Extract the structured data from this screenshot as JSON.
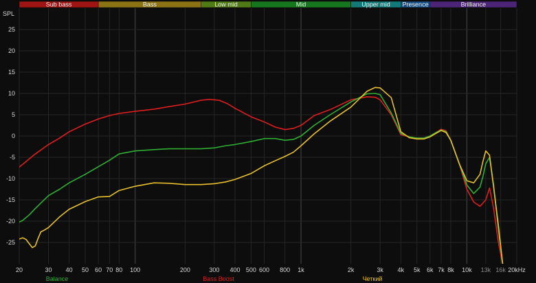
{
  "chart_data": {
    "type": "line",
    "title": "",
    "xlabel": "",
    "ylabel": "SPL",
    "x_scale": "log",
    "xlim": [
      20,
      20000
    ],
    "ylim": [
      -30,
      30
    ],
    "grid": true,
    "background": "#0d0d0d",
    "grid_color": "#2e2e2e",
    "bands": [
      {
        "label": "Sub bass",
        "from": 20,
        "to": 60,
        "color": "#a01414"
      },
      {
        "label": "Bass",
        "from": 60,
        "to": 250,
        "color": "#8c7414"
      },
      {
        "label": "Low mid",
        "from": 250,
        "to": 500,
        "color": "#4f7a14"
      },
      {
        "label": "Mid",
        "from": 500,
        "to": 2000,
        "color": "#16781e"
      },
      {
        "label": "Upper mid",
        "from": 2000,
        "to": 4000,
        "color": "#127a78"
      },
      {
        "label": "Presence",
        "from": 4000,
        "to": 6000,
        "color": "#154e86"
      },
      {
        "label": "Brilliance",
        "from": 6000,
        "to": 20000,
        "color": "#4c2578"
      }
    ],
    "x_ticks": [
      {
        "value": 20,
        "label": "20",
        "dim": false
      },
      {
        "value": 30,
        "label": "30",
        "dim": false
      },
      {
        "value": 40,
        "label": "40",
        "dim": false
      },
      {
        "value": 50,
        "label": "50",
        "dim": false
      },
      {
        "value": 60,
        "label": "60",
        "dim": false
      },
      {
        "value": 70,
        "label": "70",
        "dim": false
      },
      {
        "value": 80,
        "label": "80",
        "dim": false
      },
      {
        "value": 100,
        "label": "100",
        "dim": false
      },
      {
        "value": 200,
        "label": "200",
        "dim": false
      },
      {
        "value": 300,
        "label": "300",
        "dim": false
      },
      {
        "value": 400,
        "label": "400",
        "dim": false
      },
      {
        "value": 500,
        "label": "500",
        "dim": false
      },
      {
        "value": 600,
        "label": "600",
        "dim": false
      },
      {
        "value": 800,
        "label": "800",
        "dim": false
      },
      {
        "value": 1000,
        "label": "1k",
        "dim": false
      },
      {
        "value": 2000,
        "label": "2k",
        "dim": false
      },
      {
        "value": 3000,
        "label": "3k",
        "dim": false
      },
      {
        "value": 4000,
        "label": "4k",
        "dim": false
      },
      {
        "value": 5000,
        "label": "5k",
        "dim": false
      },
      {
        "value": 6000,
        "label": "6k",
        "dim": false
      },
      {
        "value": 7000,
        "label": "7k",
        "dim": false
      },
      {
        "value": 8000,
        "label": "8k",
        "dim": false
      },
      {
        "value": 10000,
        "label": "10k",
        "dim": false
      },
      {
        "value": 13000,
        "label": "13k",
        "dim": true
      },
      {
        "value": 16000,
        "label": "16k",
        "dim": true
      },
      {
        "value": 20000,
        "label": "20kHz",
        "dim": false
      }
    ],
    "y_ticks": [
      25,
      20,
      15,
      10,
      5,
      0,
      -5,
      -10,
      -15,
      -20,
      -25
    ],
    "major_x_gridlines": [
      100,
      1000,
      10000
    ],
    "series": [
      {
        "name": "Bass Boost",
        "color": "#e01e1e",
        "x": [
          20,
          25,
          30,
          35,
          40,
          50,
          60,
          70,
          80,
          100,
          130,
          160,
          200,
          250,
          280,
          320,
          360,
          400,
          500,
          600,
          700,
          800,
          900,
          1000,
          1200,
          1500,
          2000,
          2500,
          2800,
          3000,
          3500,
          4000,
          4500,
          5000,
          5500,
          6000,
          6500,
          7000,
          7500,
          8000,
          9000,
          10000,
          11000,
          12000,
          13000,
          13700,
          14500,
          15500,
          16500
        ],
        "y": [
          -7.3,
          -4.2,
          -2,
          -0.5,
          1,
          2.8,
          4,
          4.8,
          5.3,
          5.8,
          6.3,
          6.9,
          7.5,
          8.4,
          8.6,
          8.4,
          7.6,
          6.5,
          4.5,
          3.3,
          2.1,
          1.5,
          1.8,
          2.5,
          4.8,
          6.2,
          8.5,
          9.2,
          9.1,
          8.5,
          5,
          0.3,
          -0.2,
          -0.5,
          -0.5,
          0,
          0.8,
          1.6,
          1.2,
          -1,
          -6.5,
          -12.5,
          -15.5,
          -16.5,
          -15,
          -12.2,
          -17,
          -25,
          -30.5
        ]
      },
      {
        "name": "Balance",
        "color": "#2fb032",
        "x": [
          20,
          21,
          23,
          25,
          30,
          35,
          40,
          50,
          60,
          70,
          80,
          100,
          130,
          160,
          200,
          250,
          300,
          350,
          400,
          500,
          600,
          700,
          800,
          900,
          1000,
          1200,
          1500,
          2000,
          2500,
          2800,
          3000,
          3500,
          4000,
          4500,
          5000,
          5500,
          6000,
          6500,
          7000,
          7500,
          8000,
          9000,
          10000,
          11000,
          12000,
          12500,
          13000,
          13700,
          14500,
          15500,
          16500
        ],
        "y": [
          -20.2,
          -19.8,
          -18.5,
          -17,
          -14,
          -12.5,
          -11,
          -9,
          -7.2,
          -5.7,
          -4.2,
          -3.5,
          -3.2,
          -3,
          -3,
          -3,
          -2.8,
          -2.3,
          -2,
          -1.3,
          -0.6,
          -0.6,
          -1,
          -0.8,
          0,
          2.5,
          5,
          8,
          9.9,
          10,
          9.7,
          5.4,
          0.6,
          -0.2,
          -0.5,
          -0.5,
          0,
          0.8,
          1.4,
          1,
          -1,
          -6.5,
          -11.5,
          -13.5,
          -12,
          -9.5,
          -6.5,
          -5,
          -11.5,
          -22,
          -30.5
        ]
      },
      {
        "name": "Четкий",
        "color": "#e8c12c",
        "x": [
          20,
          21,
          22,
          23,
          24,
          25,
          26,
          27,
          28,
          30,
          35,
          40,
          50,
          60,
          70,
          80,
          100,
          130,
          160,
          200,
          250,
          300,
          350,
          400,
          500,
          600,
          700,
          800,
          900,
          1000,
          1200,
          1500,
          2000,
          2500,
          2800,
          3000,
          3500,
          4000,
          4500,
          5000,
          5500,
          6000,
          6500,
          7000,
          7500,
          8000,
          9000,
          10000,
          11000,
          12000,
          12500,
          13000,
          13700,
          14500,
          15500,
          16500
        ],
        "y": [
          -24.2,
          -23.9,
          -24.3,
          -25.3,
          -26.2,
          -25.8,
          -24,
          -22.5,
          -22.2,
          -21.5,
          -19,
          -17.2,
          -15.4,
          -14.3,
          -14.2,
          -12.8,
          -11.8,
          -11,
          -11.1,
          -11.4,
          -11.4,
          -11.2,
          -10.8,
          -10.2,
          -8.8,
          -7,
          -5.8,
          -4.8,
          -3.8,
          -2.3,
          0.5,
          3.5,
          6.8,
          10.5,
          11.4,
          11.3,
          9,
          1,
          -0.4,
          -0.7,
          -0.7,
          -0.2,
          0.6,
          1.3,
          0.8,
          -1,
          -6.5,
          -10.5,
          -11,
          -9,
          -6,
          -3.5,
          -4.5,
          -12,
          -21,
          -30.5
        ]
      }
    ]
  }
}
